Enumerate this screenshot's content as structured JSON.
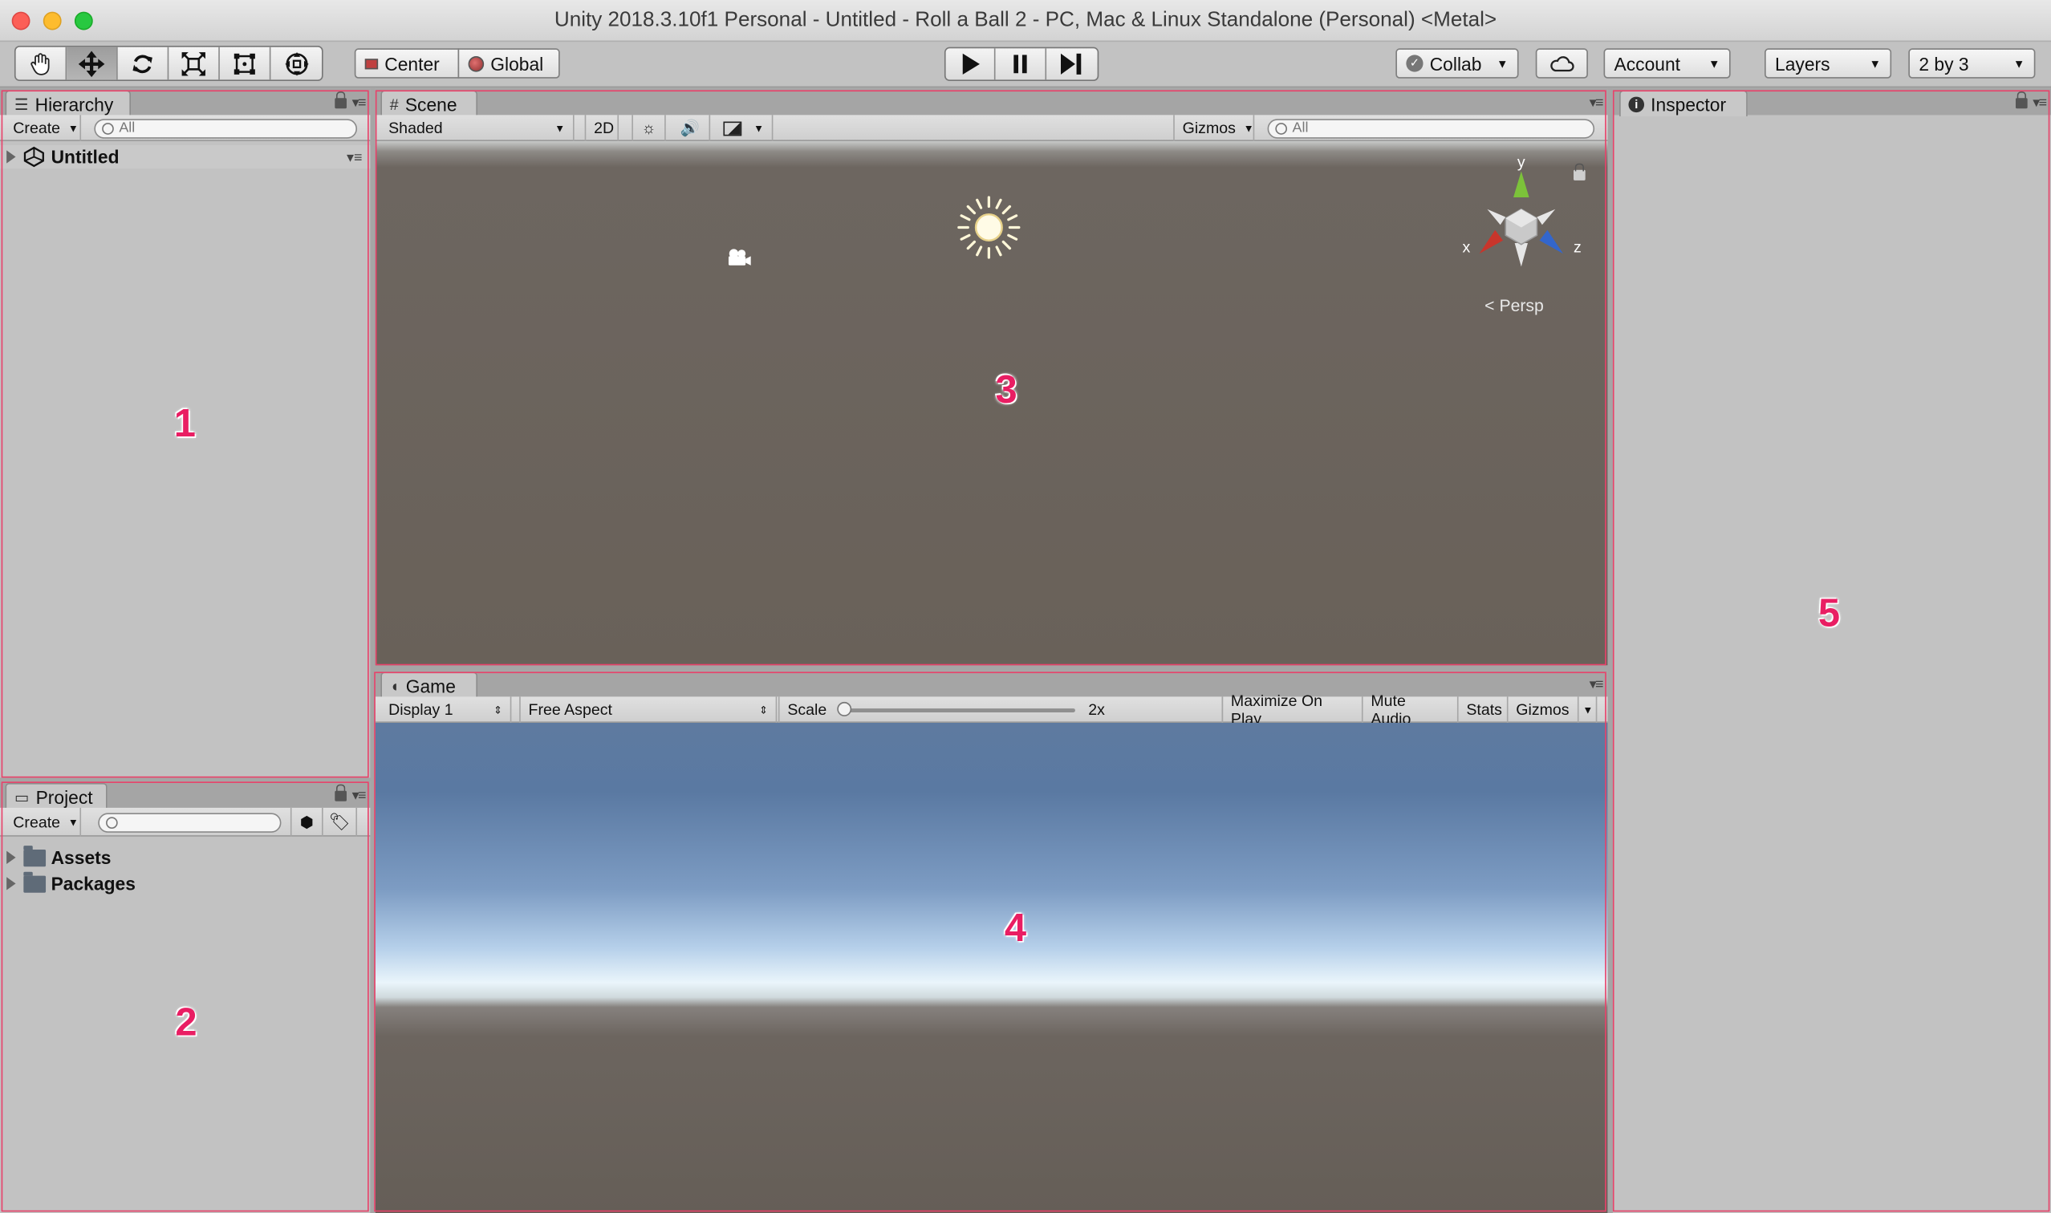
{
  "window": {
    "title": "Unity 2018.3.10f1 Personal - Untitled - Roll a Ball 2 - PC, Mac & Linux Standalone (Personal) <Metal>"
  },
  "toolbar": {
    "transform_tools": [
      "hand-tool",
      "move-tool",
      "rotate-tool",
      "scale-tool",
      "rect-tool",
      "transform-tool"
    ],
    "active_tool": "move-tool",
    "pivot_label": "Center",
    "space_label": "Global",
    "collab_label": "Collab",
    "account_label": "Account",
    "layers_label": "Layers",
    "layout_label": "2 by 3"
  },
  "hierarchy": {
    "tab_label": "Hierarchy",
    "create_label": "Create",
    "search_placeholder": "All",
    "scene_name": "Untitled"
  },
  "project": {
    "tab_label": "Project",
    "create_label": "Create",
    "folders": [
      "Assets",
      "Packages"
    ]
  },
  "scene": {
    "tab_label": "Scene",
    "shading_mode": "Shaded",
    "mode_2d_label": "2D",
    "gizmos_label": "Gizmos",
    "search_placeholder": "All",
    "gizmo_axes": {
      "y": "y",
      "x": "x",
      "z": "z"
    },
    "projection_label": "Persp"
  },
  "game": {
    "tab_label": "Game",
    "display_label": "Display 1",
    "aspect_label": "Free Aspect",
    "scale_label": "Scale",
    "scale_value": "2x",
    "maximize_label": "Maximize On Play",
    "mute_label": "Mute Audio",
    "stats_label": "Stats",
    "gizmos_label": "Gizmos"
  },
  "inspector": {
    "tab_label": "Inspector"
  },
  "annotations": [
    "1",
    "2",
    "3",
    "4",
    "5"
  ],
  "colors": {
    "annotation": "#e91e63",
    "panel_bg": "#c2c2c2",
    "x_axis": "#c8352b",
    "y_axis": "#7cc23a",
    "z_axis": "#3366cc"
  }
}
